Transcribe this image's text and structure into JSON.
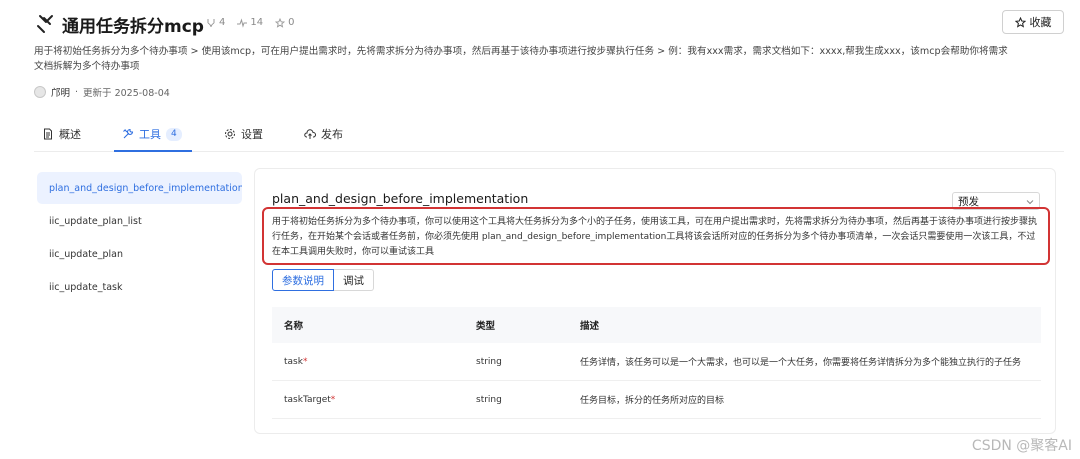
{
  "header": {
    "title": "通用任务拆分mcp",
    "stats": {
      "forks": "4",
      "activity": "14",
      "stars": "0"
    },
    "favorite_label": "收藏"
  },
  "description": "用于将初始任务拆分为多个待办事项 > 使用该mcp，可在用户提出需求时，先将需求拆分为待办事项，然后再基于该待办事项进行按步骤执行任务 > 例：我有xxx需求，需求文档如下：xxxx,帮我生成xxx，该mcp会帮助你将需求文档拆解为多个待办事项",
  "meta": {
    "author": "邝明",
    "separator": "·",
    "updated": "更新于 2025-08-04"
  },
  "tabs": [
    {
      "label": "概述",
      "icon": "document-icon"
    },
    {
      "label": "工具",
      "icon": "tools-icon",
      "badge": "4"
    },
    {
      "label": "设置",
      "icon": "gear-icon"
    },
    {
      "label": "发布",
      "icon": "upload-cloud-icon"
    }
  ],
  "tools_list": [
    "plan_and_design_before_implementation ...",
    "iic_update_plan_list",
    "iic_update_plan",
    "iic_update_task"
  ],
  "tool_detail": {
    "title": "plan_and_design_before_implementation",
    "env": "预发",
    "description": "用于将初始任务拆分为多个待办事项，你可以使用这个工具将大任务拆分为多个小的子任务，使用该工具，可在用户提出需求时，先将需求拆分为待办事项，然后再基于该待办事项进行按步骤执行任务，在开始某个会话或者任务前，你必须先使用 plan_and_design_before_implementation工具将该会话所对应的任务拆分为多个待办事项清单，一次会话只需要使用一次该工具，不过在本工具调用失败时，你可以重试该工具",
    "sub_tabs": [
      "参数说明",
      "调试"
    ],
    "table": {
      "headers": [
        "名称",
        "类型",
        "描述"
      ],
      "rows": [
        {
          "name": "task",
          "required_mark": "*",
          "type": "string",
          "desc": "任务详情，该任务可以是一个大需求，也可以是一个大任务，你需要将任务详情拆分为多个能独立执行的子任务"
        },
        {
          "name": "taskTarget",
          "required_mark": "*",
          "type": "string",
          "desc": "任务目标，拆分的任务所对应的目标"
        }
      ]
    }
  },
  "watermark": "CSDN @聚客AI",
  "colors": {
    "accent": "#2f6fe0",
    "highlight_border": "#d23434"
  }
}
